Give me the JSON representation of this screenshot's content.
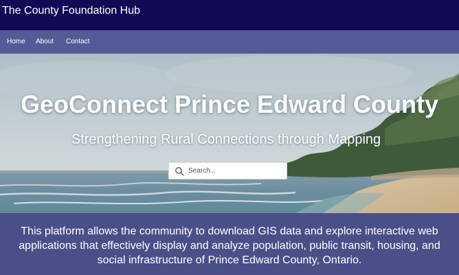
{
  "header": {
    "title": "The County Foundation Hub"
  },
  "nav": {
    "items": [
      {
        "label": "Home"
      },
      {
        "label": "About"
      },
      {
        "label": "Contact"
      }
    ]
  },
  "hero": {
    "title": "GeoConnect Prince Edward County",
    "subtitle": "Strengthening Rural Connections through Mapping",
    "search": {
      "placeholder": "Search..."
    },
    "background_image": "lake shoreline with sandy beach and trees"
  },
  "description": {
    "text": "This platform allows the community to download GIS data and explore interactive web applications that effectively display and analyze population, public transit, housing, and social infrastructure of Prince Edward County, Ontario."
  },
  "colors": {
    "header_bg": "#120a55",
    "nav_bg": "#535b96",
    "description_bg": "#4b4f88"
  }
}
